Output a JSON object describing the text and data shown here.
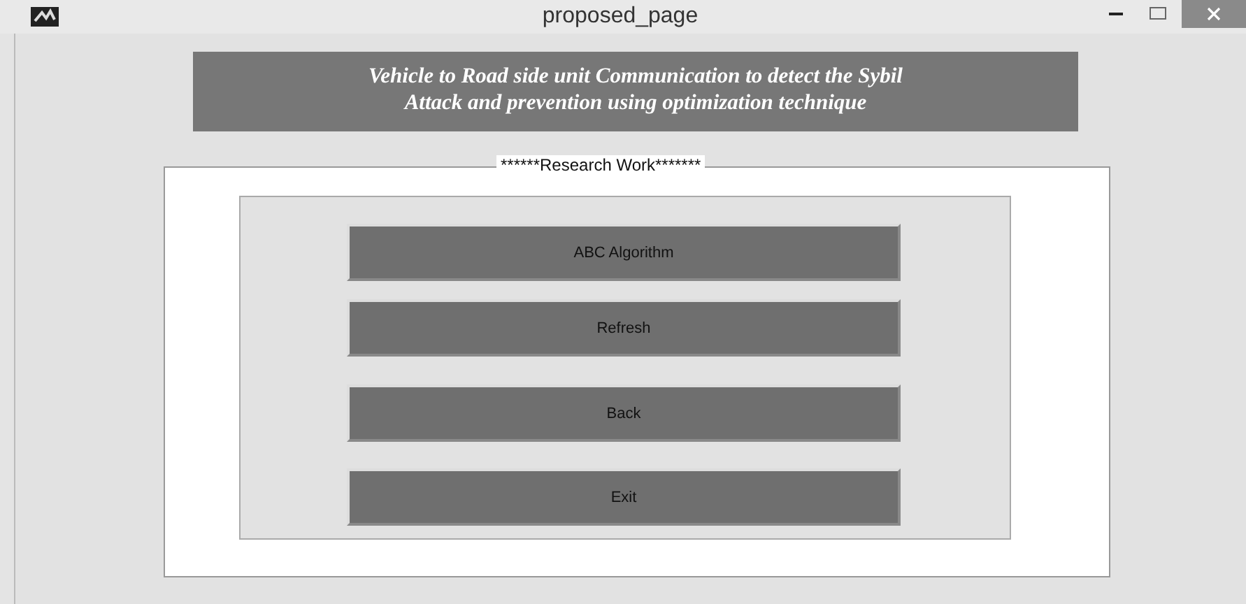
{
  "window": {
    "title": "proposed_page"
  },
  "banner": {
    "lines": [
      "Vehicle to Road side unit Communication to detect the  Sybil",
      "Attack and prevention using optimization technique"
    ]
  },
  "panel": {
    "title": "******Research Work*******"
  },
  "buttons": [
    "ABC Algorithm",
    "Refresh",
    "Back",
    "Exit"
  ]
}
